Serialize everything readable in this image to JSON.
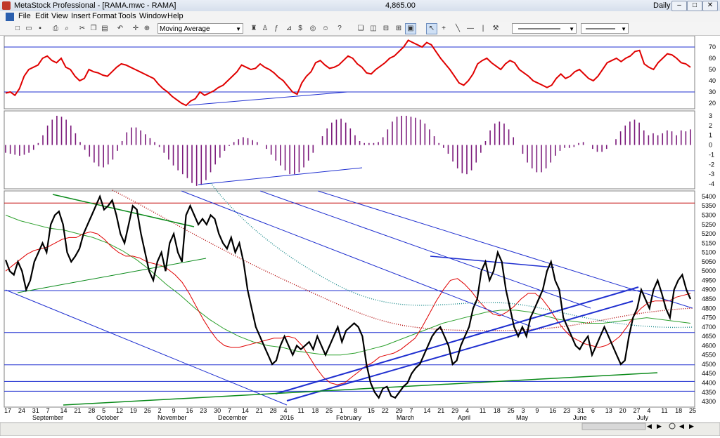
{
  "window": {
    "title": "MetaStock Professional - [RAMA.mwc - RAMA]",
    "last_price": "4,865.00",
    "period": "Daily",
    "controls": [
      "–",
      "□",
      "✕"
    ]
  },
  "menu": [
    "File",
    "Edit",
    "View",
    "Insert",
    "Format",
    "Tools",
    "Window",
    "Help"
  ],
  "toolbar": {
    "indicator_select": "Moving Average"
  },
  "colors": {
    "price": "#000000",
    "rsi": "#e00000",
    "macd_hist": "#7b1a7b",
    "trend_blue": "#1f2fd0",
    "trend_green": "#0a8a1a",
    "horizontal_red": "#c00000",
    "ma_fast": "#e00000",
    "ma_mid": "#2ca02c",
    "ma_slow_dotted": "#b00000",
    "ma_teal_dotted": "#1a8a8a"
  },
  "chart_data": [
    {
      "type": "line",
      "panel": "oscillator-top",
      "ylim": [
        15,
        80
      ],
      "y_ticks": [
        70,
        60,
        50,
        40,
        30,
        20
      ],
      "reference_levels": [
        70,
        30
      ],
      "series": [
        {
          "values": [
            29,
            30,
            27,
            33,
            44,
            50,
            52,
            54,
            60,
            62,
            58,
            56,
            60,
            52,
            50,
            44,
            40,
            42,
            50,
            48,
            47,
            45,
            44,
            48,
            52,
            55,
            54,
            52,
            50,
            48,
            46,
            44,
            42,
            37,
            33,
            30,
            26,
            23,
            20,
            18,
            22,
            24,
            30,
            27,
            29,
            31,
            34,
            36,
            40,
            44,
            48,
            54,
            52,
            50,
            51,
            55,
            52,
            50,
            47,
            43,
            40,
            35,
            30,
            28,
            38,
            44,
            48,
            56,
            58,
            54,
            51,
            52,
            54,
            58,
            62,
            60,
            55,
            52,
            47,
            46,
            50,
            53,
            56,
            60,
            62,
            66,
            70,
            76,
            74,
            72,
            70,
            74,
            72,
            66,
            60,
            55,
            50,
            44,
            38,
            36,
            40,
            46,
            55,
            58,
            60,
            56,
            53,
            50,
            55,
            58,
            56,
            50,
            47,
            44,
            40,
            38,
            36,
            34,
            36,
            42,
            46,
            42,
            44,
            48,
            50,
            46,
            42,
            40,
            44,
            50,
            56,
            58,
            60,
            57,
            60,
            62,
            66,
            67,
            55,
            52,
            50,
            56,
            60,
            64,
            63,
            60,
            56,
            55,
            52
          ]
        }
      ]
    },
    {
      "type": "bar",
      "panel": "oscillator-histogram",
      "ylim": [
        -4.5,
        3.5
      ],
      "y_ticks": [
        3,
        2,
        1,
        0,
        -1,
        -2,
        -3,
        -4
      ],
      "series": [
        {
          "values": [
            -0.8,
            -0.9,
            -1.0,
            -1.1,
            -1.0,
            -0.8,
            -0.5,
            0.2,
            1.0,
            2.0,
            2.6,
            3.0,
            2.9,
            2.6,
            2.0,
            1.2,
            0.3,
            -0.5,
            -1.2,
            -1.8,
            -2.2,
            -2.3,
            -2.0,
            -1.5,
            -0.6,
            0.4,
            1.3,
            1.8,
            1.8,
            1.5,
            1.1,
            0.7,
            0.3,
            -0.2,
            -0.8,
            -1.5,
            -2.1,
            -2.6,
            -3.0,
            -3.4,
            -3.9,
            -4.2,
            -4.1,
            -3.6,
            -2.8,
            -2.0,
            -1.3,
            -0.6,
            -0.1,
            0.3,
            0.6,
            0.8,
            0.7,
            0.5,
            0.3,
            0.0,
            -0.4,
            -1.0,
            -1.6,
            -2.1,
            -2.6,
            -3.0,
            -3.0,
            -2.8,
            -2.3,
            -1.6,
            -0.8,
            0.0,
            0.9,
            1.7,
            2.3,
            2.6,
            2.7,
            2.3,
            1.7,
            1.0,
            0.4,
            0.2,
            0.2,
            0.2,
            0.3,
            0.8,
            1.6,
            2.4,
            2.9,
            3.0,
            3.0,
            2.9,
            2.8,
            2.6,
            2.2,
            1.6,
            0.9,
            0.2,
            -0.3,
            -0.9,
            -1.7,
            -2.4,
            -2.9,
            -3.0,
            -2.6,
            -1.8,
            -0.8,
            0.4,
            1.5,
            2.2,
            2.4,
            2.2,
            1.6,
            0.8,
            0.0,
            -0.9,
            -1.8,
            -2.4,
            -2.8,
            -2.8,
            -2.4,
            -1.8,
            -1.1,
            -0.6,
            -0.3,
            -0.3,
            -0.2,
            0.2,
            0.3,
            0.0,
            -0.4,
            -0.7,
            -0.7,
            -0.4,
            0.0,
            0.6,
            1.4,
            2.0,
            2.4,
            2.6,
            2.3,
            1.5,
            1.0,
            1.2,
            1.0,
            1.2,
            1.5,
            1.4,
            1.0,
            1.5,
            1.4,
            1.6
          ]
        }
      ]
    },
    {
      "type": "line",
      "panel": "price",
      "ylim": [
        4270,
        5430
      ],
      "y_ticks": [
        5400,
        5350,
        5300,
        5250,
        5200,
        5150,
        5100,
        5050,
        5000,
        4950,
        4900,
        4850,
        4800,
        4750,
        4700,
        4650,
        4600,
        4550,
        4500,
        4450,
        4400,
        4350,
        4300
      ],
      "x_ticks": [
        "17",
        "24",
        "31",
        "7",
        "14",
        "21",
        "28",
        "5",
        "12",
        "19",
        "26",
        "2",
        "9",
        "16",
        "23",
        "30",
        "7",
        "14",
        "21",
        "28",
        "4",
        "11",
        "18",
        "25",
        "1",
        "8",
        "15",
        "22",
        "29",
        "7",
        "14",
        "21",
        "29",
        "4",
        "11",
        "18",
        "25",
        "3",
        "9",
        "16",
        "23",
        "31",
        "6",
        "13",
        "20",
        "27",
        "4",
        "11",
        "18",
        "25"
      ],
      "months": [
        "September",
        "October",
        "November",
        "December",
        "2016",
        "February",
        "March",
        "April",
        "May",
        "June",
        "July"
      ],
      "horizontal_levels": [
        {
          "value": 5365,
          "color": "red"
        },
        {
          "value": 4895,
          "color": "blue"
        },
        {
          "value": 4670,
          "color": "blue"
        },
        {
          "value": 4497,
          "color": "blue"
        },
        {
          "value": 4408,
          "color": "blue"
        },
        {
          "value": 4355,
          "color": "blue"
        }
      ],
      "series": [
        {
          "values": [
            5060,
            5000,
            4980,
            5050,
            5000,
            4900,
            4950,
            5050,
            5100,
            5150,
            5100,
            5250,
            5300,
            5320,
            5250,
            5100,
            5050,
            5080,
            5120,
            5200,
            5250,
            5300,
            5350,
            5400,
            5330,
            5350,
            5380,
            5300,
            5200,
            5150,
            5250,
            5350,
            5330,
            5200,
            5100,
            5000,
            4950,
            5050,
            5100,
            5000,
            5150,
            5200,
            5100,
            5050,
            5300,
            5350,
            5300,
            5250,
            5280,
            5250,
            5300,
            5280,
            5200,
            5150,
            5120,
            5180,
            5100,
            5150,
            5050,
            4900,
            4800,
            4700,
            4650,
            4600,
            4550,
            4500,
            4520,
            4600,
            4650,
            4600,
            4550,
            4600,
            4580,
            4600,
            4620,
            4580,
            4650,
            4600,
            4550,
            4600,
            4650,
            4700,
            4620,
            4680,
            4700,
            4720,
            4700,
            4650,
            4500,
            4400,
            4350,
            4320,
            4370,
            4380,
            4330,
            4320,
            4350,
            4380,
            4400,
            4450,
            4480,
            4500,
            4550,
            4600,
            4650,
            4680,
            4700,
            4650,
            4600,
            4500,
            4520,
            4600,
            4650,
            4700,
            4800,
            4850,
            5000,
            5050,
            4950,
            5000,
            5100,
            5050,
            4900,
            4800,
            4700,
            4650,
            4700,
            4650,
            4750,
            4800,
            4850,
            4900,
            5000,
            5050,
            4950,
            4900,
            4750,
            4700,
            4650,
            4600,
            4580,
            4620,
            4650,
            4550,
            4600,
            4650,
            4700,
            4650,
            4600,
            4550,
            4500,
            4520,
            4650,
            4750,
            4800,
            4900,
            4850,
            4800,
            4900,
            4950,
            4880,
            4800,
            4750,
            4900,
            4950,
            4980,
            4900,
            4850
          ]
        },
        {
          "values": [
            5000,
            5030,
            5060,
            5090,
            5110,
            5120,
            5130,
            5150,
            5170,
            5180,
            5180,
            5200,
            5210,
            5200,
            5170,
            5130,
            5100,
            5080,
            5080,
            5070,
            5050,
            5040,
            5030,
            5010,
            4980,
            4940,
            4880,
            4810,
            4740,
            4680,
            4630,
            4600,
            4590,
            4590,
            4600,
            4610,
            4620,
            4630,
            4640,
            4640,
            4650,
            4640,
            4600,
            4540,
            4480,
            4430,
            4400,
            4390,
            4400,
            4430,
            4460,
            4490,
            4510,
            4540,
            4550,
            4560,
            4580,
            4610,
            4640,
            4700,
            4770,
            4840,
            4900,
            4950,
            4960,
            4930,
            4890,
            4840,
            4800,
            4770,
            4760,
            4780,
            4810,
            4850,
            4880,
            4880,
            4850,
            4800,
            4740,
            4690,
            4650,
            4630,
            4610,
            4600,
            4590,
            4600,
            4620,
            4650,
            4700,
            4760,
            4800,
            4830,
            4840,
            4840,
            4840,
            4860,
            4870,
            4880
          ]
        },
        {
          "values": [
            5300,
            5270,
            5250,
            5230,
            5220,
            5200,
            5180,
            5150,
            5110,
            5060,
            5000,
            4930,
            4870,
            4800,
            4740,
            4690,
            4650,
            4620,
            4600,
            4590,
            4570,
            4560,
            4550,
            4550,
            4560,
            4580,
            4600,
            4630,
            4660,
            4690,
            4720,
            4740,
            4760,
            4780,
            4790,
            4790,
            4780,
            4760,
            4740,
            4730,
            4720,
            4720,
            4730,
            4740,
            4750,
            4740,
            4730,
            4720
          ]
        }
      ]
    }
  ]
}
